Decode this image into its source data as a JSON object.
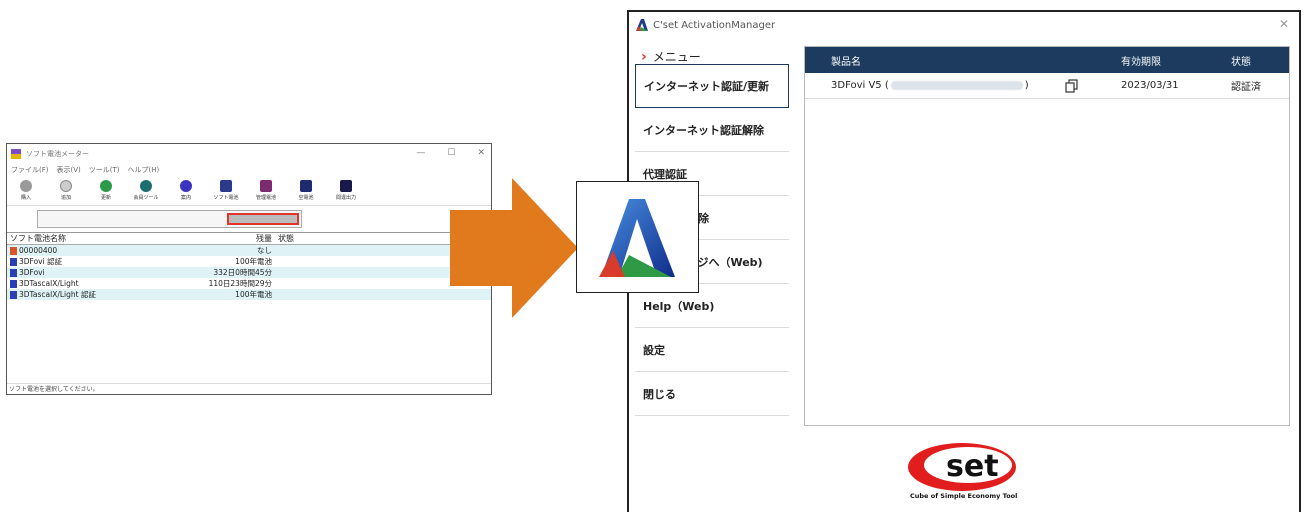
{
  "left_window": {
    "title": "ソフト電池メーター",
    "window_controls": [
      "—",
      "☐",
      "✕"
    ],
    "menu": [
      "ファイル(F)",
      "表示(V)",
      "ツール(T)",
      "ヘルプ(H)"
    ],
    "toolbar": [
      "購入",
      "追加",
      "更新",
      "会員ツール",
      "案内",
      "ソフト電池",
      "管理電池",
      "空電池",
      "間違出力"
    ],
    "columns": [
      "ソフト電池名称",
      "残量",
      "状態"
    ],
    "rows": [
      {
        "name": "00000400",
        "remaining": "なし",
        "icon": "warn"
      },
      {
        "name": "3DFovi 認証",
        "remaining": "100年電池",
        "icon": "battery"
      },
      {
        "name": "3DFovi",
        "remaining": "332日0時間45分",
        "icon": "battery"
      },
      {
        "name": "3DTascalX/Light",
        "remaining": "110日23時間29分",
        "icon": "battery"
      },
      {
        "name": "3DTascalX/Light 認証",
        "remaining": "100年電池",
        "icon": "battery"
      }
    ],
    "status": "ソフト電池を選択してください。"
  },
  "right_window": {
    "title": "C'set ActivationManager",
    "close": "✕",
    "menu_header": "メニュー",
    "menu_items": [
      "インターネット認証/更新",
      "インターネット認証解除",
      "代理認証",
      "代理認証解除",
      "ホームページへ（Web)",
      "Help（Web)",
      "設定",
      "閉じる"
    ],
    "table": {
      "columns": [
        "製品名",
        "有効期限",
        "状態"
      ],
      "rows": [
        {
          "product_prefix": "3DFovi V5 (",
          "product_suffix": ")",
          "expiry": "2023/03/31",
          "status": "認証済"
        }
      ]
    },
    "logo_text": "set",
    "logo_tagline": "Cube of Simple Economy Tool"
  },
  "colors": {
    "arrow": "#e07a1c",
    "header_bg": "#1c3b5e",
    "accent_red": "#d23a2b"
  }
}
